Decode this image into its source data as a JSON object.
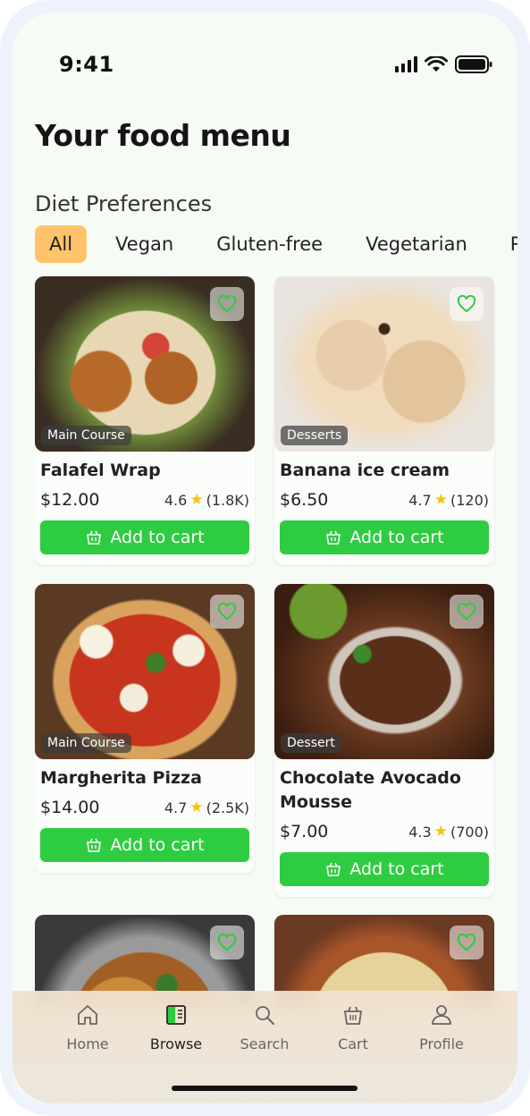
{
  "status": {
    "time": "9:41"
  },
  "header": {
    "title": "Your food menu",
    "section_title": "Diet Preferences"
  },
  "diet_chips": [
    {
      "label": "All",
      "active": true
    },
    {
      "label": "Vegan",
      "active": false
    },
    {
      "label": "Gluten-free",
      "active": false
    },
    {
      "label": "Vegetarian",
      "active": false
    },
    {
      "label": "Pal",
      "active": false
    }
  ],
  "items": [
    {
      "name": "Falafel Wrap",
      "category": "Main Course",
      "price": "$12.00",
      "rating": "4.6",
      "reviews": "(1.8K)",
      "cta": "Add to cart"
    },
    {
      "name": "Banana ice cream",
      "category": "Desserts",
      "price": "$6.50",
      "rating": "4.7",
      "reviews": "(120)",
      "cta": "Add to cart"
    },
    {
      "name": "Margherita Pizza",
      "category": "Main Course",
      "price": "$14.00",
      "rating": "4.7",
      "reviews": "(2.5K)",
      "cta": "Add to cart"
    },
    {
      "name": "Chocolate Avocado Mousse",
      "category": "Dessert",
      "price": "$7.00",
      "rating": "4.3",
      "reviews": "(700)",
      "cta": "Add to cart"
    }
  ],
  "tabs": [
    {
      "label": "Home",
      "icon": "home-icon"
    },
    {
      "label": "Browse",
      "icon": "browse-icon",
      "active": true
    },
    {
      "label": "Search",
      "icon": "search-icon"
    },
    {
      "label": "Cart",
      "icon": "cart-icon"
    },
    {
      "label": "Profile",
      "icon": "profile-icon"
    }
  ],
  "colors": {
    "accent_green": "#2ecc40",
    "chip_active": "#ffc46b",
    "star": "#f7c20f"
  }
}
